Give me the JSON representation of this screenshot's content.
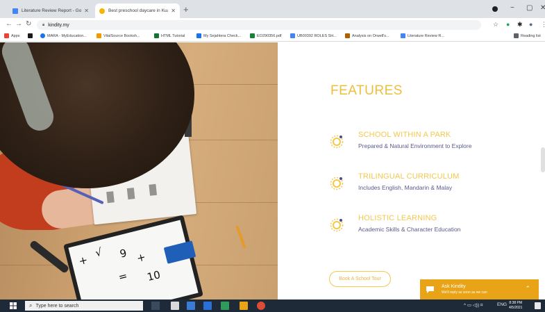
{
  "browser": {
    "tabs": [
      {
        "title": "Literature Review Report - Googl",
        "favicon_color": "#4285f4",
        "active": false
      },
      {
        "title": "Best preschool daycare in Kuala",
        "favicon_color": "#f4b400",
        "active": true
      }
    ],
    "new_tab_label": "+",
    "url": "kindity.my",
    "bookmarks": [
      {
        "label": "Apps",
        "color": "#ea4335"
      },
      {
        "label": "",
        "color": "#1a1a1a"
      },
      {
        "label": "MARA - MyEducation...",
        "color": "#1a73e8"
      },
      {
        "label": "VitalSource Booksh...",
        "color": "#f29900"
      },
      {
        "label": "HTML Tutorial",
        "color": "#137333"
      },
      {
        "label": "My Sejahtera Check...",
        "color": "#1a73e8"
      },
      {
        "label": "EO290356.pdf",
        "color": "#188038"
      },
      {
        "label": "UB00392 ROLES SH...",
        "color": "#4285f4"
      },
      {
        "label": "Analysis on Orwell's...",
        "color": "#b06000"
      },
      {
        "label": "Literature Review R...",
        "color": "#4285f4"
      }
    ],
    "reading_list_label": "Reading list",
    "window_controls": {
      "minimize": "−",
      "maximize": "▢",
      "close": "✕"
    }
  },
  "page": {
    "features_title": "FEATURES",
    "features": [
      {
        "heading": "SCHOOL WITHIN A PARK",
        "subtitle": "Prepared & Natural Environment to Explore"
      },
      {
        "heading": "TRILINGUAL CURRICULUM",
        "subtitle": "Includes English, Mandarin & Malay"
      },
      {
        "heading": "HOLISTIC LEARNING",
        "subtitle": "Academic Skills & Character Education"
      }
    ],
    "tour_button": "Book A School Tour",
    "chat": {
      "name": "Ask Kindity",
      "note": "We'll reply as soon as we can"
    },
    "accent_color": "#f3c84a"
  },
  "taskbar": {
    "search_placeholder": "Type here to search",
    "tray_label": "ENG",
    "time": "8:38 PM",
    "date": "4/5/2021"
  }
}
